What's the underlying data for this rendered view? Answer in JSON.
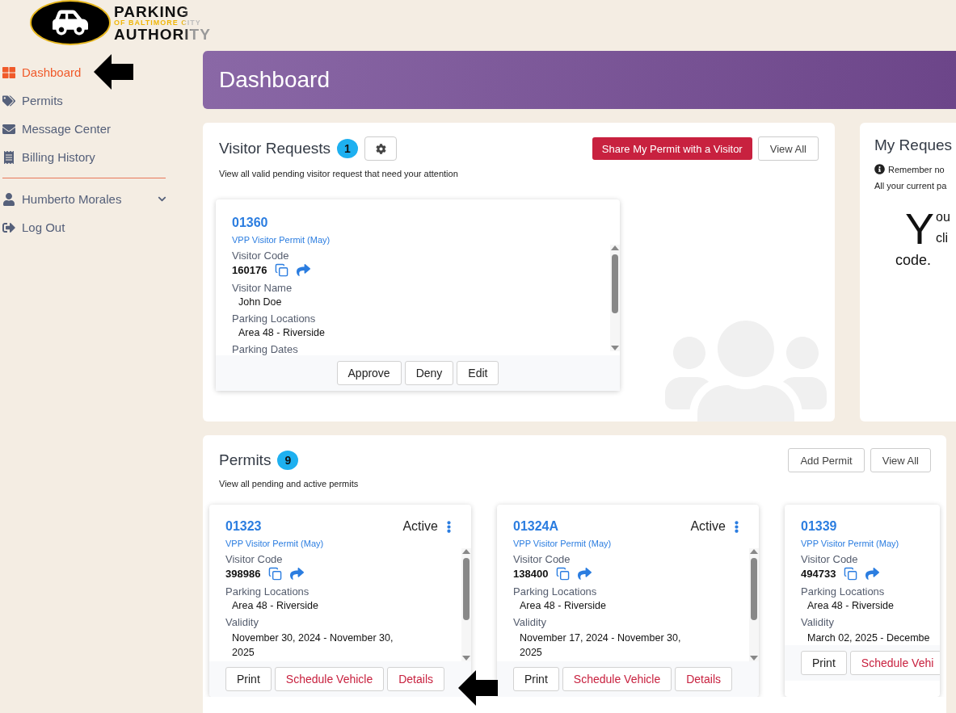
{
  "logo": {
    "line1": "PARKING",
    "line2": "OF BALTIMORE CITY",
    "line3": "AUTHORITY"
  },
  "sidebar": {
    "items": [
      {
        "label": "Dashboard",
        "selected": true
      },
      {
        "label": "Permits",
        "selected": false
      },
      {
        "label": "Message Center",
        "selected": false
      },
      {
        "label": "Billing History",
        "selected": false
      }
    ],
    "user": {
      "name": "Humberto Morales",
      "expanded": false
    },
    "logout": "Log Out"
  },
  "header": {
    "title": "Dashboard"
  },
  "visitor_requests": {
    "title": "Visitor Requests",
    "count": "1",
    "subtitle": "View all valid pending visitor request that need your attention",
    "share_button": "Share My Permit with a Visitor",
    "view_all": "View All",
    "request": {
      "number": "01360",
      "type": "VPP Visitor Permit (May)",
      "fields": [
        {
          "label": "Visitor Code",
          "value": "160176",
          "kind": "code"
        },
        {
          "label": "Visitor Name",
          "value": "John Doe",
          "kind": "text"
        },
        {
          "label": "Parking Locations",
          "value": "Area 48 - Riverside",
          "kind": "text"
        },
        {
          "label": "Parking Dates",
          "kind": "label"
        }
      ],
      "buttons": [
        "Approve",
        "Deny",
        "Edit"
      ]
    }
  },
  "my_requests": {
    "title": "My Reques",
    "notice": "Remember no",
    "description": "All your current pa",
    "drop_cap": "Y",
    "lines": [
      "ou",
      "cli"
    ],
    "last_line": "code."
  },
  "permits": {
    "title": "Permits",
    "count": "9",
    "subtitle": "View all pending and active permits",
    "add_button": "Add Permit",
    "view_all": "View All",
    "cards": [
      {
        "number": "01323",
        "status": "Active",
        "type": "VPP Visitor Permit (May)",
        "code": "398986",
        "location": "Area 48 - Riverside",
        "validity": "November 30, 2024 - November 30, 2025",
        "buttons": [
          {
            "label": "Print",
            "kind": "plain"
          },
          {
            "label": "Schedule Vehicle",
            "kind": "danger"
          },
          {
            "label": "Details",
            "kind": "danger"
          }
        ]
      },
      {
        "number": "01324A",
        "status": "Active",
        "type": "VPP Visitor Permit (May)",
        "code": "138400",
        "location": "Area 48 - Riverside",
        "validity": "November 17, 2024 - November 30, 2025",
        "buttons": [
          {
            "label": "Print",
            "kind": "plain"
          },
          {
            "label": "Schedule Vehicle",
            "kind": "danger"
          },
          {
            "label": "Details",
            "kind": "danger"
          }
        ]
      },
      {
        "number": "01339",
        "type": "VPP Visitor Permit (May)",
        "code": "494733",
        "location": "Area 48 - Riverside",
        "validity": "March 02, 2025 - Decembe",
        "buttons": [
          {
            "label": "Print",
            "kind": "plain"
          },
          {
            "label": "Schedule Vehi",
            "kind": "danger"
          }
        ]
      }
    ],
    "labels": [
      {
        "code": "Visitor Code",
        "location": "Parking Locations",
        "validity": "Validity"
      },
      {
        "code": "Visitor Code",
        "location": "Parking Locations",
        "validity": "Validity"
      },
      {
        "code": "Visitor Code",
        "location": "Parking Locations",
        "validity": "Validity"
      }
    ]
  }
}
